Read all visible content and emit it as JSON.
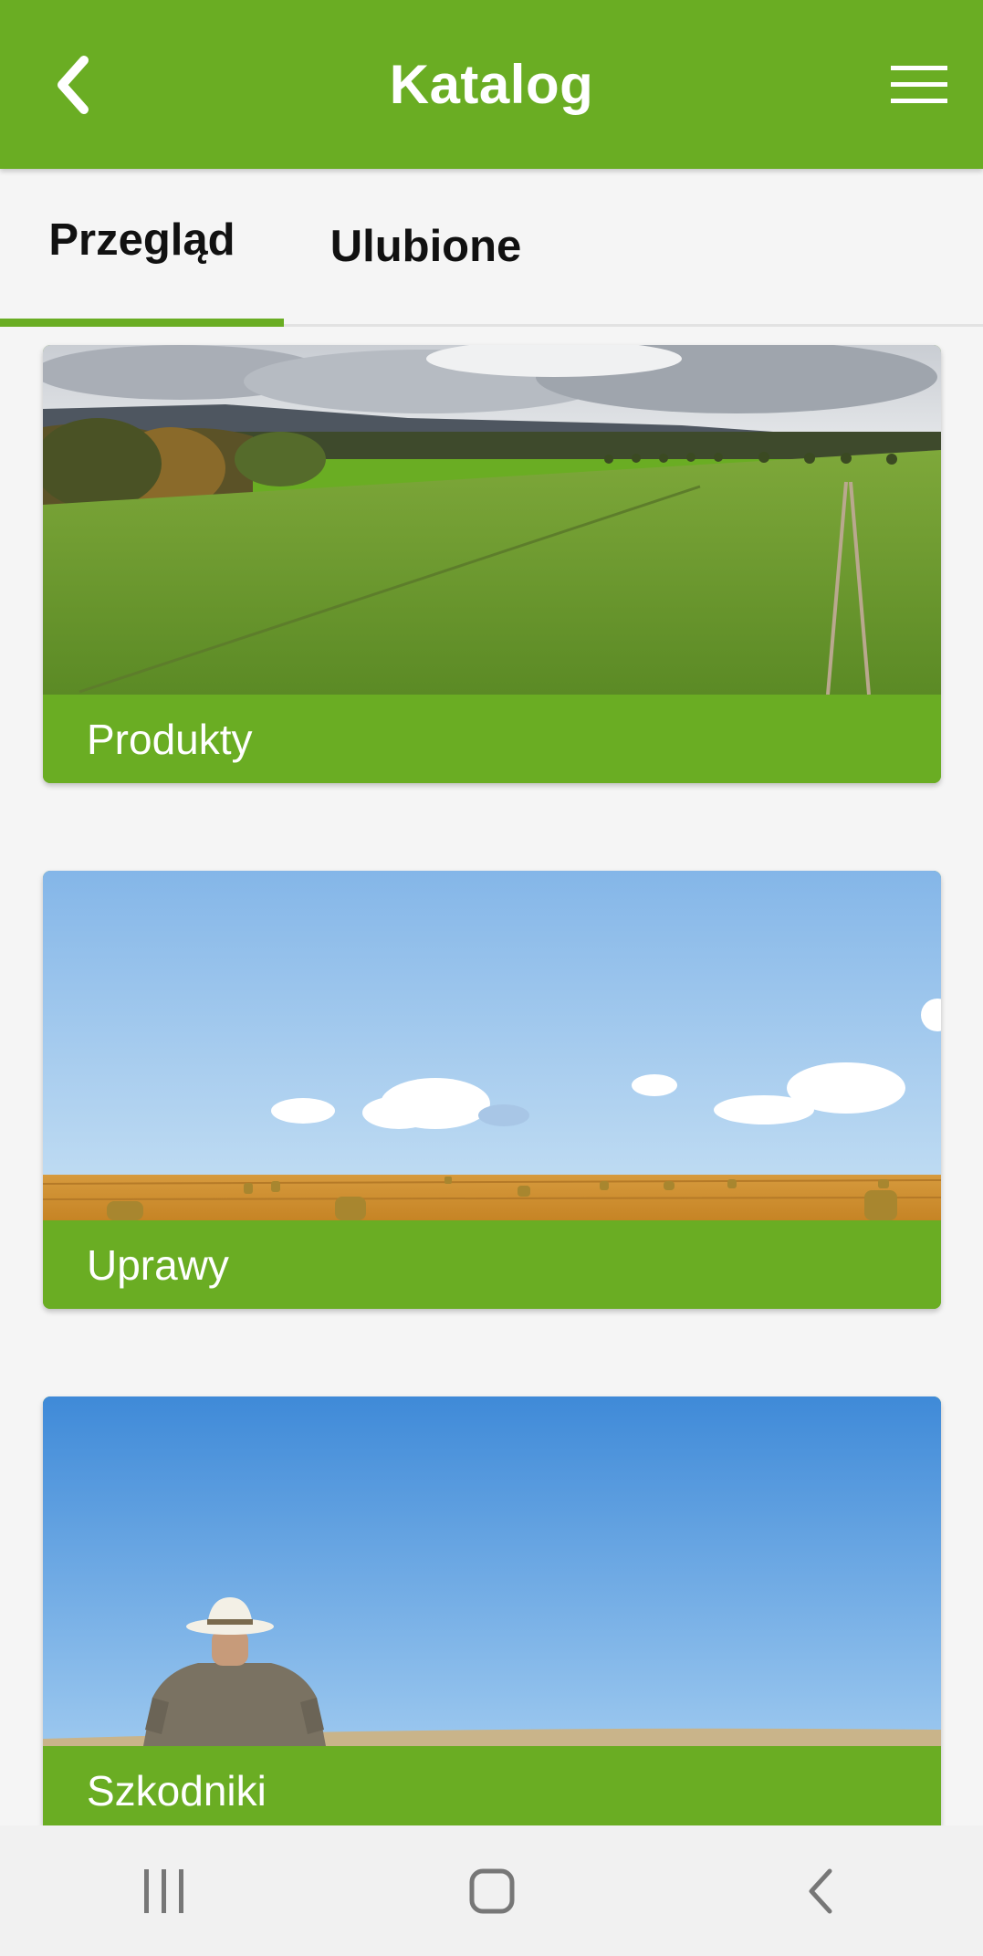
{
  "appbar": {
    "title": "Katalog",
    "back_icon": "chevron-left-icon",
    "menu_icon": "hamburger-menu-icon",
    "color": "#6aad23"
  },
  "tabs": [
    {
      "label": "Przegląd",
      "selected": true
    },
    {
      "label": "Ulubione",
      "selected": false
    }
  ],
  "cards": [
    {
      "label": "Produkty",
      "image": "green-field-landscape"
    },
    {
      "label": "Uprawy",
      "image": "hay-bales-field-blue-sky"
    },
    {
      "label": "Szkodniki",
      "image": "farmer-with-hat-wheat-field"
    }
  ],
  "system_nav": {
    "recent_icon": "recent-apps-icon",
    "home_icon": "home-icon",
    "back_icon": "back-icon"
  }
}
